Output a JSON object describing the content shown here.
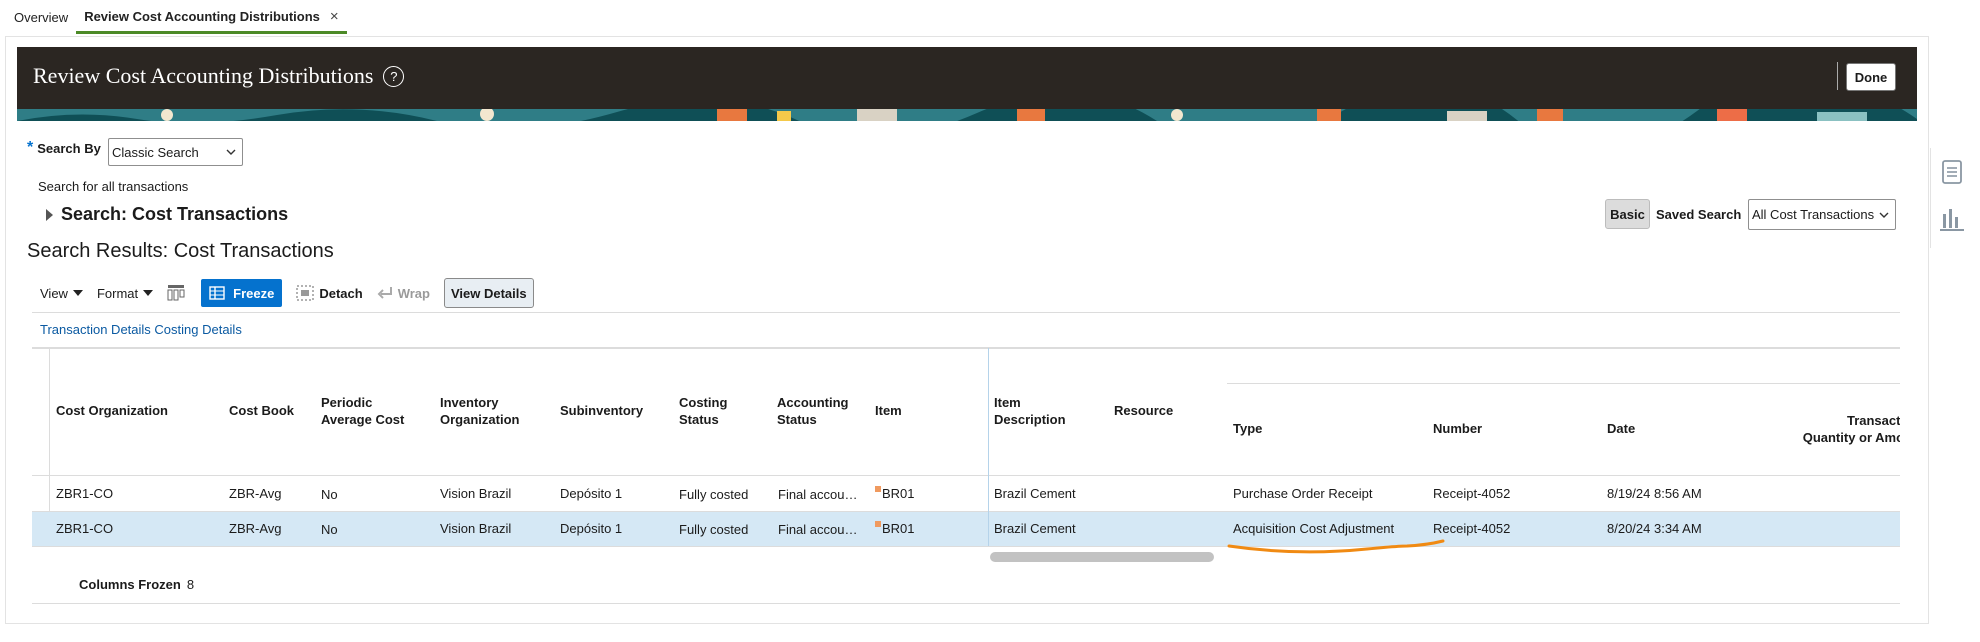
{
  "tabs": [
    {
      "label": "Overview"
    },
    {
      "label": "Review Cost Accounting Distributions",
      "close": "×"
    }
  ],
  "header": {
    "title": "Review Cost Accounting Distributions",
    "help": "?",
    "done_label": "Done"
  },
  "search": {
    "by_label": "Search By",
    "required_marker": "*",
    "by_value": "Classic Search",
    "hint": "Search for all transactions",
    "title": "Search: Cost Transactions",
    "basic_label": "Basic",
    "saved_label": "Saved Search",
    "saved_value": "All Cost Transactions"
  },
  "results": {
    "title": "Search Results: Cost Transactions",
    "toolbar": {
      "view": "View",
      "format": "Format",
      "freeze": "Freeze",
      "detach": "Detach",
      "wrap": "Wrap",
      "view_details": "View Details"
    },
    "breadcrumb": "Transaction Details Costing Details",
    "columns": [
      {
        "label": "Cost Organization"
      },
      {
        "label": "Cost Book"
      },
      {
        "label": "Periodic\nAverage Cost"
      },
      {
        "label": "Inventory\nOrganization"
      },
      {
        "label": "Subinventory"
      },
      {
        "label": "Costing\nStatus"
      },
      {
        "label": "Accounting\nStatus"
      },
      {
        "label": "Item"
      },
      {
        "label": "Item\nDescription"
      },
      {
        "label": "Resource"
      },
      {
        "label": "Type"
      },
      {
        "label": "Number"
      },
      {
        "label": "Date"
      },
      {
        "label": "Transactio\nQuantity or Amou"
      }
    ],
    "rows": [
      [
        "ZBR1-CO",
        "ZBR-Avg",
        "No",
        "Vision Brazil",
        "Depósito 1",
        "Fully costed",
        "Final accou…",
        "BR01",
        "Brazil Cement",
        "",
        "Purchase Order Receipt",
        "Receipt-4052",
        "8/19/24 8:56 AM",
        ""
      ],
      [
        "ZBR1-CO",
        "ZBR-Avg",
        "No",
        "Vision Brazil",
        "Depósito 1",
        "Fully costed",
        "Final accou…",
        "BR01",
        "Brazil Cement",
        "",
        "Acquisition Cost Adjustment",
        "Receipt-4052",
        "8/20/24 3:34 AM",
        ""
      ]
    ],
    "frozen_label": "Columns Frozen",
    "frozen_count": "8"
  },
  "colors": {
    "banner": "#2b2622",
    "accent": "#0572ce",
    "selected_row": "#d5e8f5",
    "annotation": "#f08a13"
  },
  "icons": [
    "chevron-down-icon",
    "expand-triangle-icon",
    "help-icon",
    "close-icon",
    "freeze-icon",
    "detach-icon",
    "wrap-icon",
    "column-icon",
    "document-panel-icon",
    "bar-chart-icon"
  ]
}
